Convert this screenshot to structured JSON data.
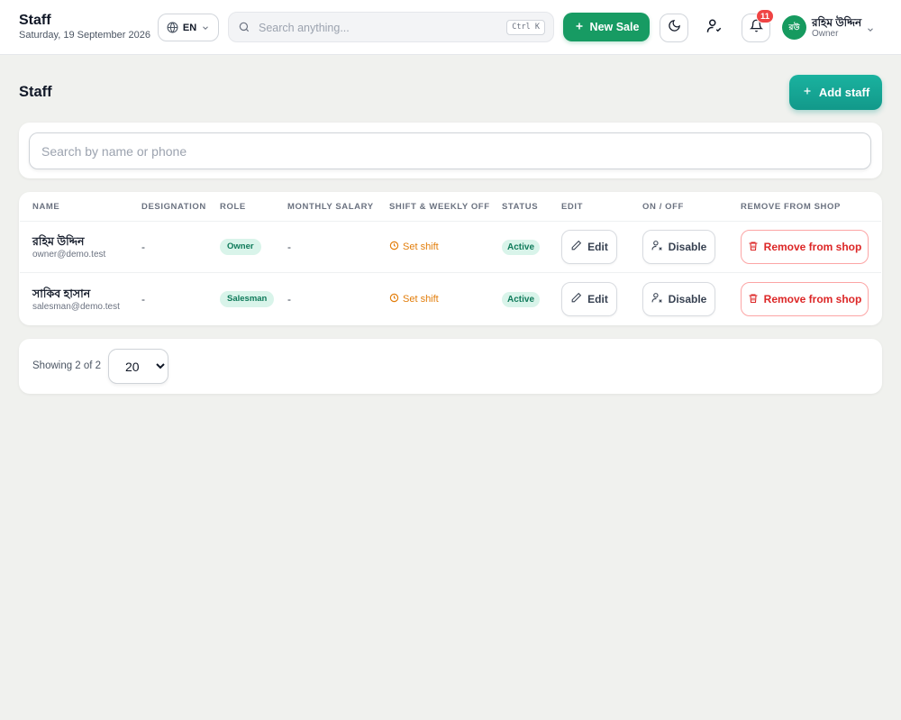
{
  "header": {
    "title": "Staff",
    "date": "Saturday, 19 September 2026",
    "language": "EN",
    "search_placeholder": "Search anything...",
    "search_shortcut": "Ctrl K",
    "new_sale_label": "New Sale",
    "notification_count": "11",
    "user": {
      "initials": "রউ",
      "name": "রহিম উদ্দিন",
      "role": "Owner"
    }
  },
  "page": {
    "title": "Staff",
    "add_button_label": "Add staff",
    "search_placeholder": "Search by name or phone"
  },
  "table": {
    "columns": [
      "NAME",
      "DESIGNATION",
      "ROLE",
      "MONTHLY SALARY",
      "SHIFT & WEEKLY OFF",
      "STATUS",
      "EDIT",
      "ON / OFF",
      "REMOVE FROM SHOP"
    ],
    "rows": [
      {
        "name": "রহিম উদ্দিন",
        "email": "owner@demo.test",
        "designation": "-",
        "role": "Owner",
        "salary": "-",
        "shift": "Set shift",
        "status": "Active",
        "edit": "Edit",
        "toggle": "Disable",
        "remove": "Remove from shop"
      },
      {
        "name": "সাকিব হাসান",
        "email": "salesman@demo.test",
        "designation": "-",
        "role": "Salesman",
        "salary": "-",
        "shift": "Set shift",
        "status": "Active",
        "edit": "Edit",
        "toggle": "Disable",
        "remove": "Remove from shop"
      }
    ]
  },
  "pagination": {
    "showing_text": "Showing 2 of 2",
    "page_size": "20"
  },
  "colors": {
    "primary_green": "#179b63",
    "teal": "#12998a",
    "danger": "#dc2626",
    "warning": "#e27d0a",
    "badge_red": "#ef4444"
  }
}
